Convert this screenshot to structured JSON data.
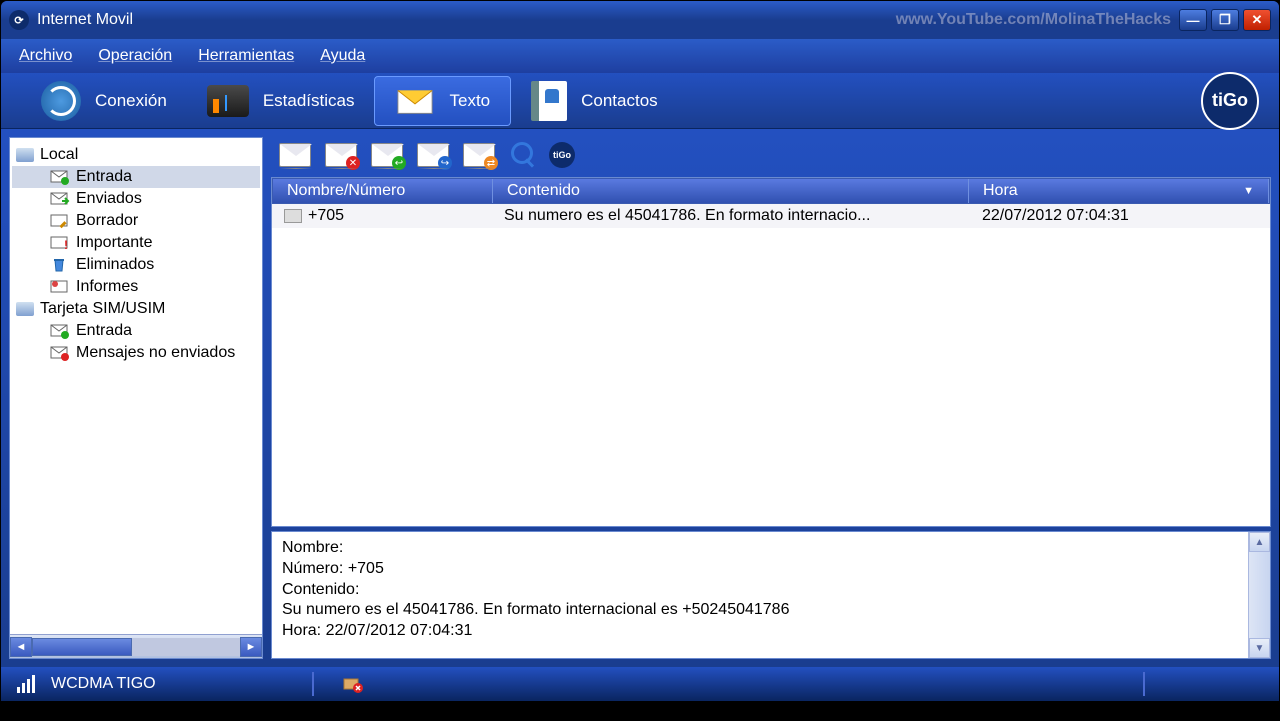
{
  "window": {
    "title": "Internet Movil"
  },
  "watermark": "www.YouTube.com/MolinaTheHacks",
  "menu": {
    "archivo": "Archivo",
    "operacion": "Operación",
    "herramientas": "Herramientas",
    "ayuda": "Ayuda"
  },
  "tabs": {
    "conexion": "Conexión",
    "estadisticas": "Estadísticas",
    "texto": "Texto",
    "contactos": "Contactos"
  },
  "brand": "tiGo",
  "sidebar": {
    "local": "Local",
    "entrada": "Entrada",
    "enviados": "Enviados",
    "borrador": "Borrador",
    "importante": "Importante",
    "eliminados": "Eliminados",
    "informes": "Informes",
    "sim": "Tarjeta SIM/USIM",
    "sim_entrada": "Entrada",
    "no_enviados": "Mensajes no enviados"
  },
  "columns": {
    "name": "Nombre/Número",
    "content": "Contenido",
    "time": "Hora"
  },
  "messages": [
    {
      "name": "+705",
      "content": "Su numero es el 45041786. En formato internacio...",
      "time": "22/07/2012 07:04:31"
    }
  ],
  "preview": {
    "nombre_label": "Nombre:",
    "numero_label": "Número:",
    "numero": "+705",
    "contenido_label": "Contenido:",
    "contenido": "Su numero es el 45041786. En formato internacional es +50245041786",
    "hora_label": "Hora:",
    "hora": "22/07/2012 07:04:31"
  },
  "status": {
    "network": "WCDMA  TIGO"
  }
}
